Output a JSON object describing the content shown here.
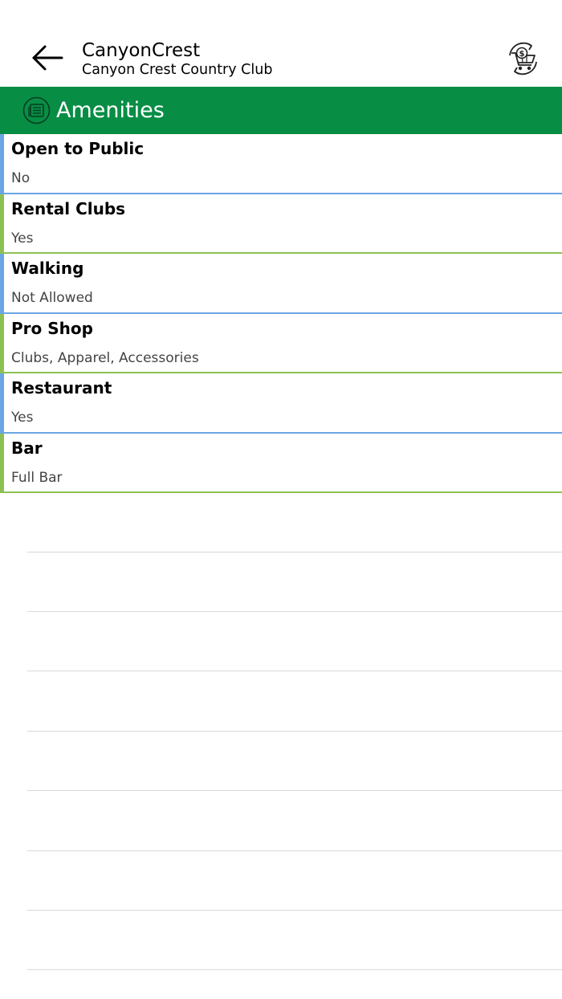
{
  "header": {
    "back_icon": "arrow-left-icon",
    "title": "CanyonCrest",
    "subtitle": "Canyon Crest Country Club",
    "cart_icon": "shopping-cart-dollar-refresh-icon"
  },
  "section": {
    "icon": "list-document-icon",
    "title": "Amenities",
    "color": "#088d45"
  },
  "accent_colors": {
    "blue": "#6aa6e4",
    "green": "#8cc152"
  },
  "amenities": [
    {
      "name": "Open to Public",
      "value": "No"
    },
    {
      "name": "Rental Clubs",
      "value": "Yes"
    },
    {
      "name": "Walking",
      "value": "Not Allowed"
    },
    {
      "name": "Pro Shop",
      "value": "Clubs, Apparel, Accessories"
    },
    {
      "name": "Restaurant",
      "value": "Yes"
    },
    {
      "name": "Bar",
      "value": "Full Bar"
    }
  ]
}
